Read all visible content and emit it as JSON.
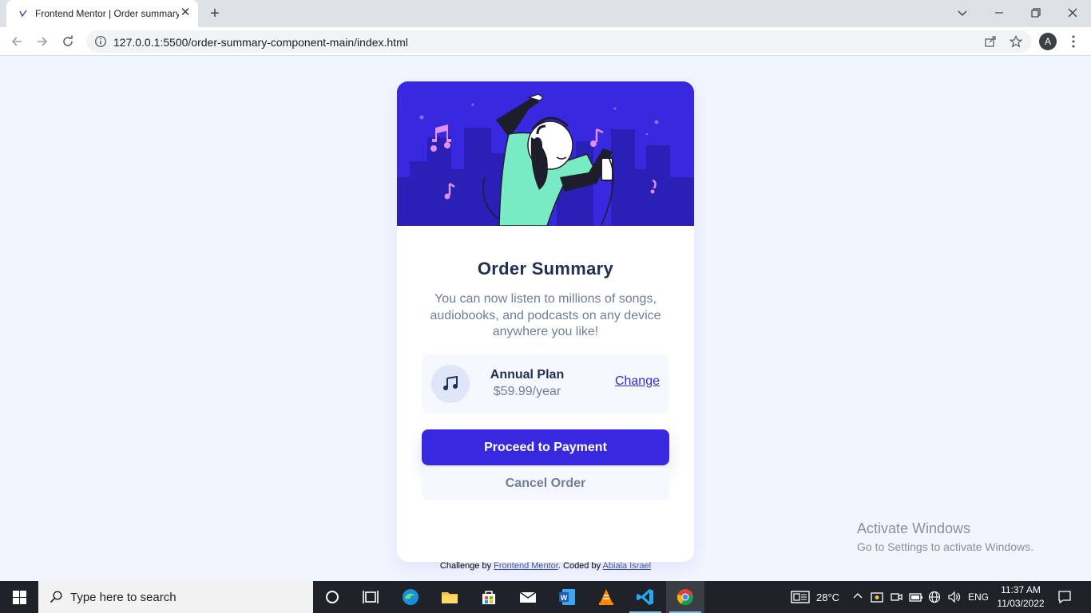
{
  "browser": {
    "tab_title": "Frontend Mentor | Order summary",
    "url": "127.0.0.1:5500/order-summary-component-main/index.html",
    "profile_initial": "A"
  },
  "card": {
    "title": "Order Summary",
    "description": "You can now listen to millions of songs, audiobooks, and podcasts on any device anywhere you like!",
    "plan_name": "Annual Plan",
    "plan_price": "$59.99/year",
    "change_link": "Change",
    "pay_button": "Proceed to Payment",
    "cancel_button": "Cancel Order"
  },
  "attribution": {
    "prefix": "Challenge by ",
    "fm_link": "Frontend Mentor",
    "middle": ". Coded by ",
    "author_link": "Abiala Israel"
  },
  "watermark": {
    "line1": "Activate Windows",
    "line2": "Go to Settings to activate Windows."
  },
  "taskbar": {
    "search_placeholder": "Type here to search",
    "weather": "28°C",
    "language": "ENG",
    "time": "11:37 AM",
    "date": "11/03/2022"
  },
  "colors": {
    "primary": "#3829e0",
    "dark_blue": "#1f2f56",
    "desaturated_blue": "#717e97",
    "pale_blue": "#f1f5fe"
  }
}
